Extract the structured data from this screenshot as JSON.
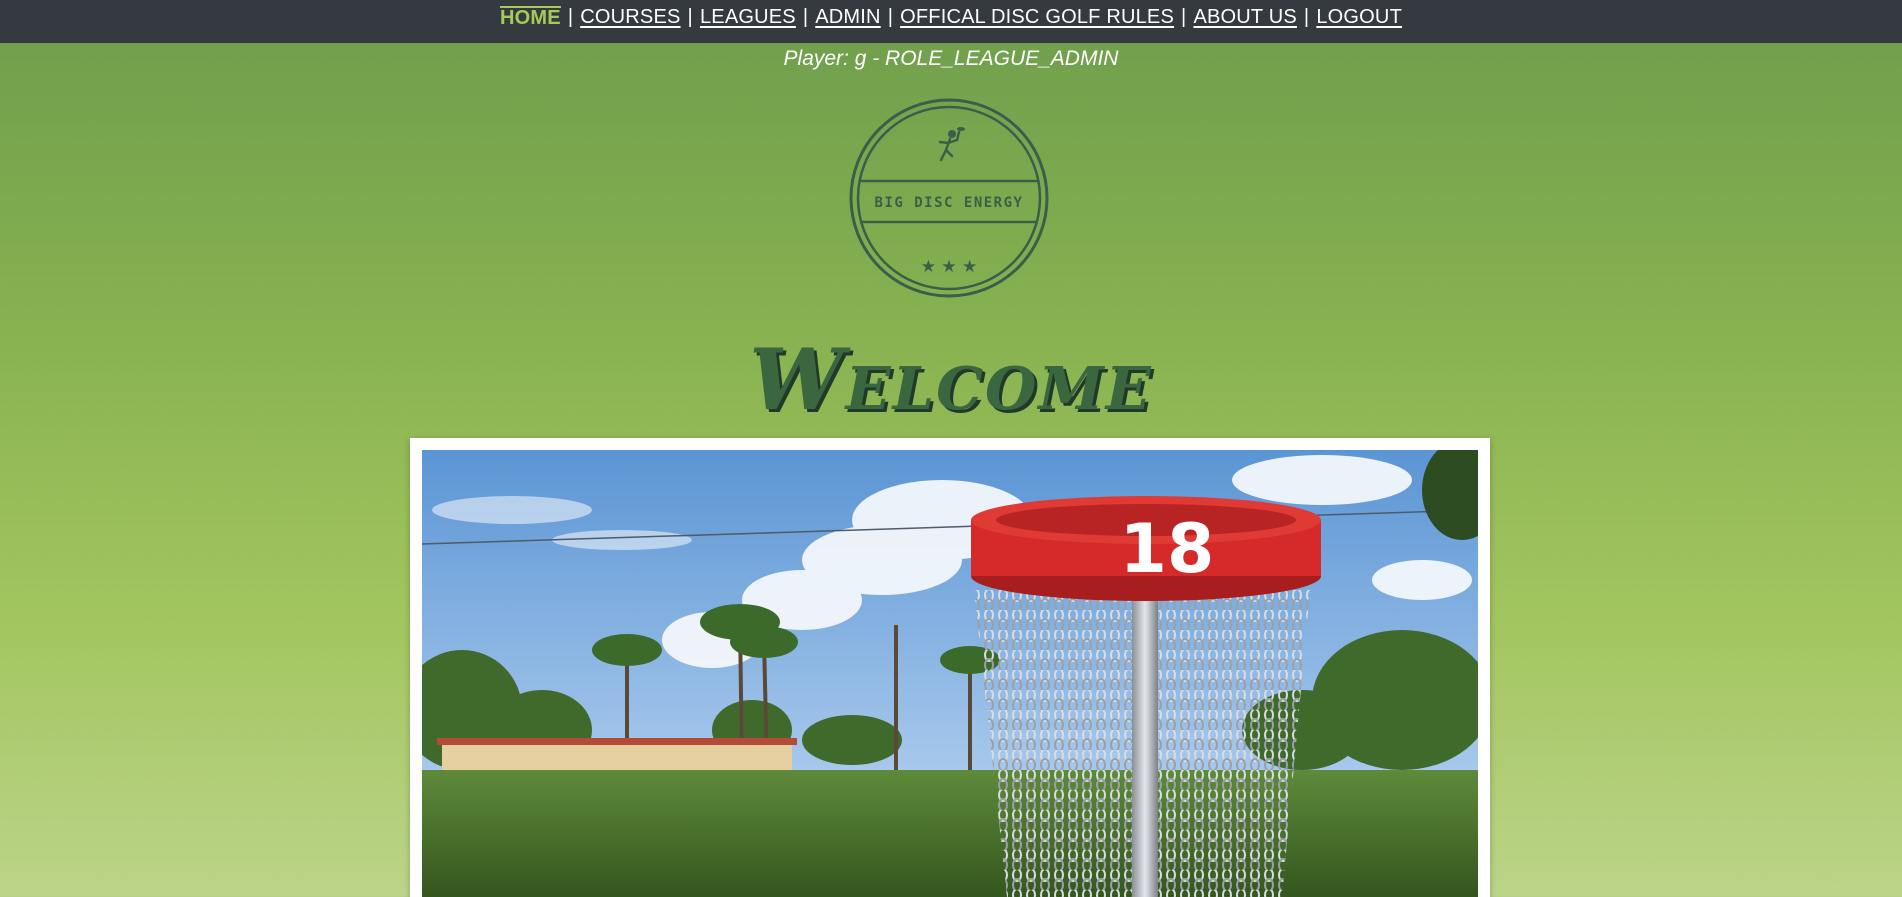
{
  "nav": {
    "items": [
      {
        "label": "HOME",
        "active": true
      },
      {
        "label": "COURSES",
        "active": false
      },
      {
        "label": "LEAGUES",
        "active": false
      },
      {
        "label": "ADMIN",
        "active": false
      },
      {
        "label": "OFFICAL DISC GOLF RULES",
        "active": false
      },
      {
        "label": "ABOUT US",
        "active": false
      },
      {
        "label": "LOGOUT",
        "active": false
      }
    ],
    "separator": "|"
  },
  "player": {
    "text": "Player: g - ROLE_LEAGUE_ADMIN"
  },
  "logo": {
    "text": "BIG DISC ENERGY",
    "stars": "★ ★ ★",
    "color": "#3b5e4a"
  },
  "welcome": {
    "title": "Welcome"
  },
  "hero": {
    "basket_number": "18"
  },
  "colors": {
    "nav_bg": "#343a40",
    "nav_active": "#a7c957",
    "basket_red": "#d62a2a"
  }
}
